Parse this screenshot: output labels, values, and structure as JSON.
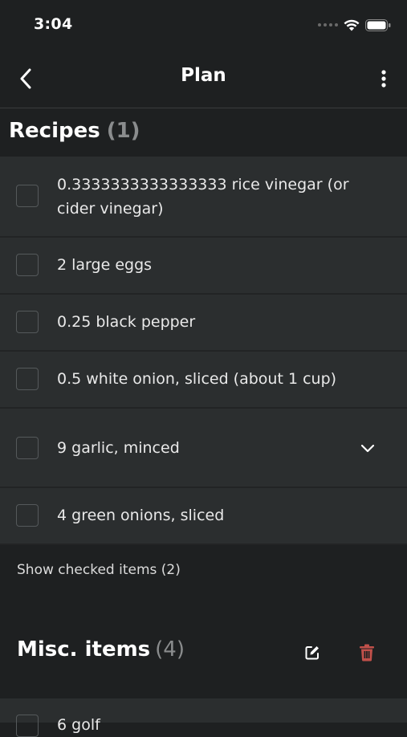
{
  "status_bar": {
    "time": "3:04",
    "icons": [
      "signal-dots-icon",
      "wifi-icon",
      "battery-icon"
    ]
  },
  "nav": {
    "title": "Plan",
    "back_icon": "chevron-left-icon",
    "more_icon": "more-vertical-icon"
  },
  "recipes_section": {
    "title": "Recipes",
    "count": "(1)"
  },
  "items": [
    {
      "label": "0.3333333333333333 rice vinegar (or cider vinegar)",
      "checked": false,
      "expandable": false
    },
    {
      "label": "2 large eggs",
      "checked": false,
      "expandable": false
    },
    {
      "label": "0.25 black pepper",
      "checked": false,
      "expandable": false
    },
    {
      "label": "0.5 white onion, sliced (about 1 cup)",
      "checked": false,
      "expandable": false
    },
    {
      "label": "9 garlic, minced",
      "checked": false,
      "expandable": true
    },
    {
      "label": "4 green onions, sliced",
      "checked": false,
      "expandable": false
    }
  ],
  "show_checked": "Show checked items (2)",
  "misc_section": {
    "title": "Misc. items",
    "count": "(4)",
    "edit_icon": "edit-icon",
    "delete_icon": "trash-icon",
    "delete_color": "#c0504a"
  },
  "misc_items": [
    {
      "label": "6 golf",
      "checked": false
    }
  ],
  "colors": {
    "background": "#1e2021",
    "row_background": "#2b2e2f",
    "text": "#e9e9e9",
    "muted": "#8a8c8d"
  }
}
